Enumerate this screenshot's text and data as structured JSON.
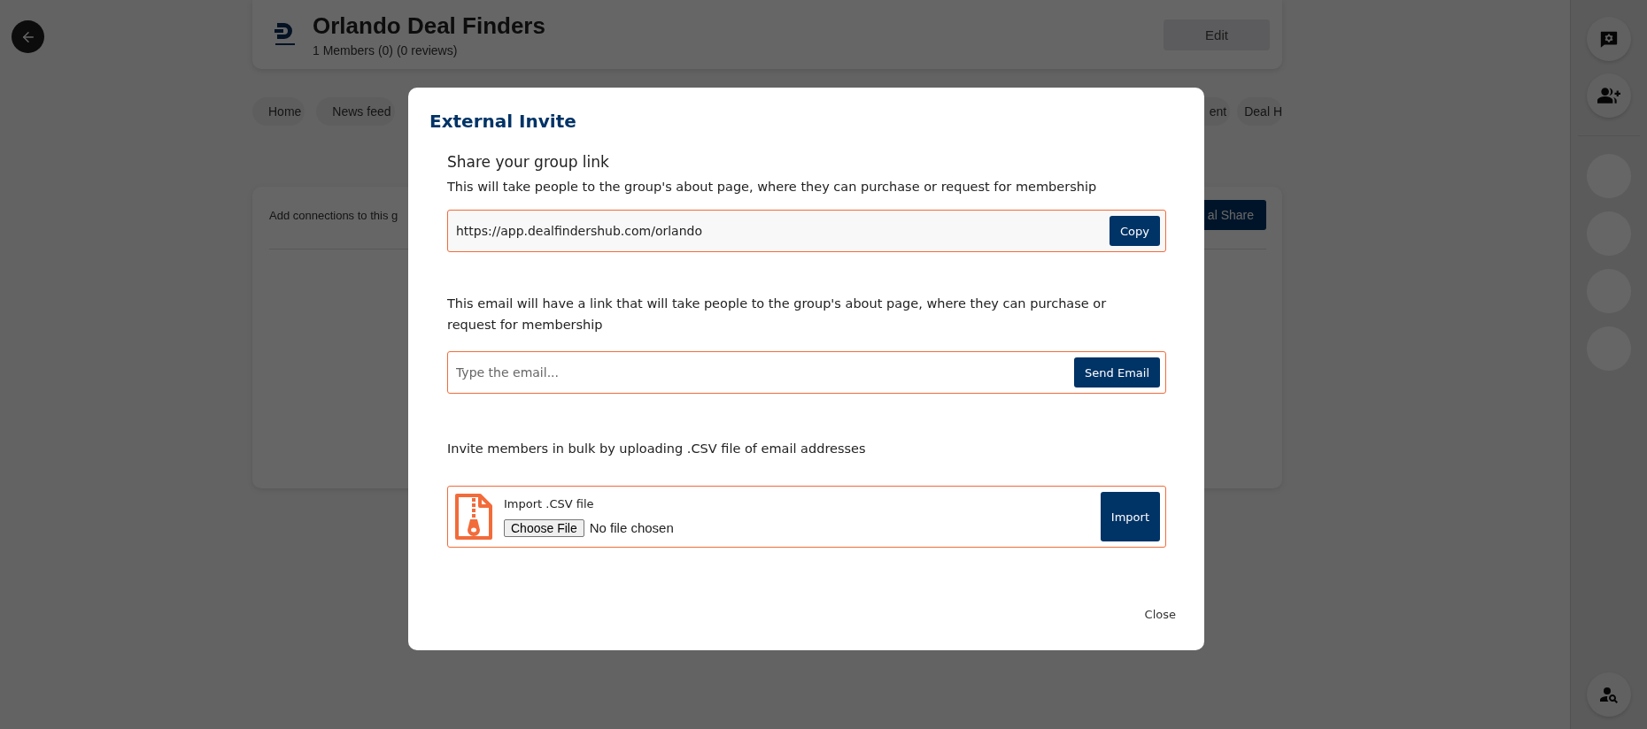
{
  "group": {
    "name": "Orlando Deal Finders",
    "stats": "1 Members (0) (0 reviews)",
    "edit_button": "Edit"
  },
  "tabs": [
    {
      "label": "Home",
      "selected": false
    },
    {
      "label": "News feed",
      "selected": false
    },
    {
      "label": "ent",
      "selected": false
    },
    {
      "label": "Deal H",
      "selected": false
    }
  ],
  "connections_card": {
    "text": "Add connections to this g",
    "button": "al Share"
  },
  "sidebar": {
    "items": [
      {
        "kind": "chat-settings"
      },
      {
        "kind": "add-group"
      },
      {
        "kind": "placeholder"
      },
      {
        "kind": "placeholder"
      },
      {
        "kind": "placeholder"
      },
      {
        "kind": "placeholder"
      },
      {
        "kind": "person-search"
      }
    ]
  },
  "modal": {
    "title": "External Invite",
    "link_section": {
      "heading": "Share your group link",
      "description": "This will take people to the group's about page, where they can purchase or request for membership",
      "value": "https://app.dealfindershub.com/orlando",
      "button": "Copy"
    },
    "email_section": {
      "description": "This email will have a link that will take people to the group's about page, where they can purchase or request for membership",
      "placeholder": "Type the email...",
      "button": "Send Email"
    },
    "bulk_section": {
      "description": "Invite members in bulk by uploading .CSV file of email addresses",
      "label": "Import .CSV file",
      "choose_button": "Choose File",
      "file_status": "No file chosen",
      "button": "Import"
    },
    "close_button": "Close"
  }
}
